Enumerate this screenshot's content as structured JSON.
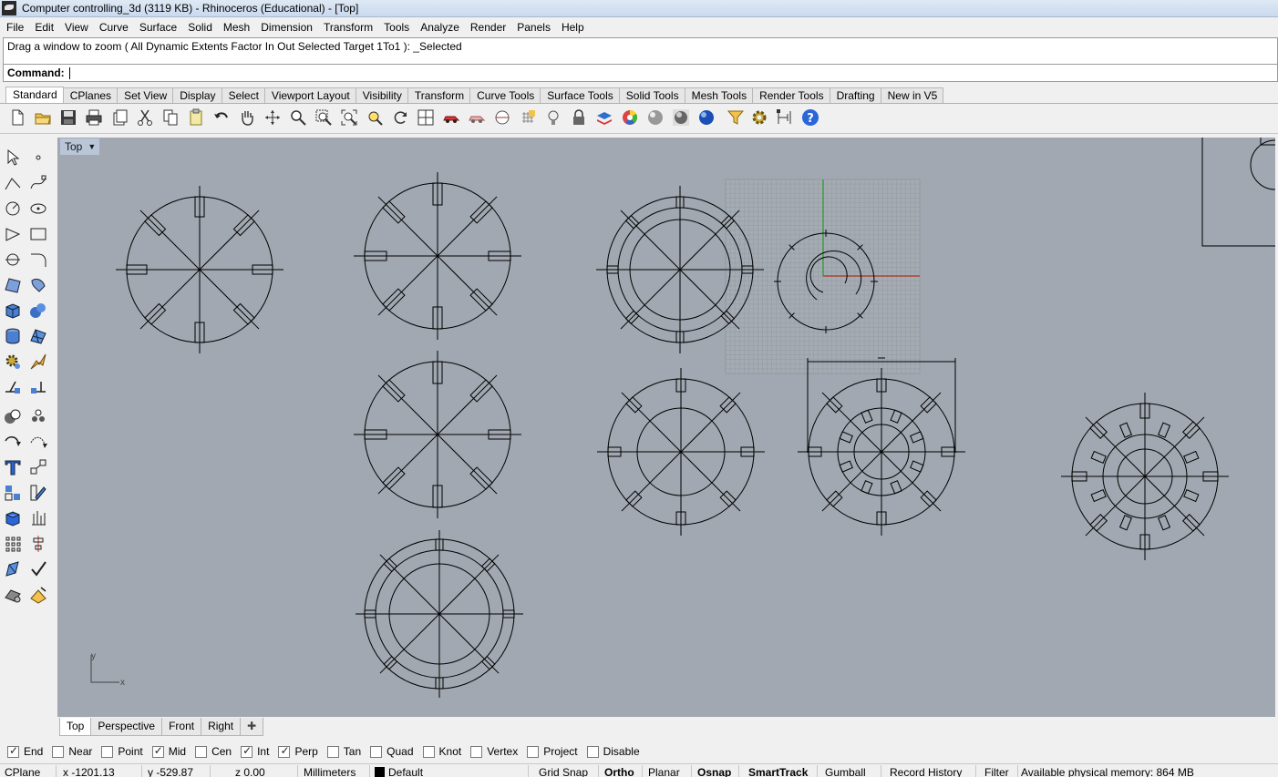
{
  "title": "Computer controlling_3d (3119 KB) - Rhinoceros (Educational) - [Top]",
  "menu": [
    "File",
    "Edit",
    "View",
    "Curve",
    "Surface",
    "Solid",
    "Mesh",
    "Dimension",
    "Transform",
    "Tools",
    "Analyze",
    "Render",
    "Panels",
    "Help"
  ],
  "command": {
    "history": "Drag a window to zoom ( All  Dynamic  Extents  Factor  In  Out  Selected  Target  1To1 ): _Selected",
    "label": "Command:",
    "value": ""
  },
  "toolbar_tabs": [
    "Standard",
    "CPlanes",
    "Set View",
    "Display",
    "Select",
    "Viewport Layout",
    "Visibility",
    "Transform",
    "Curve Tools",
    "Surface Tools",
    "Solid Tools",
    "Mesh Tools",
    "Render Tools",
    "Drafting",
    "New in V5"
  ],
  "toolbar_icons": [
    "new-file-icon",
    "open-folder-icon",
    "save-icon",
    "print-icon",
    "import-icon",
    "cut-icon",
    "copy-icon",
    "paste-icon",
    "undo-icon",
    "pan-hand-icon",
    "rotate-view-icon",
    "zoom-icon",
    "zoom-window-icon",
    "zoom-extents-icon",
    "zoom-selected-icon",
    "rotate-icon",
    "four-viewports-icon",
    "car-icon",
    "car-shaded-icon",
    "cplane-icon",
    "grid-snap-icon",
    "light-bulb-icon",
    "lock-icon",
    "layer-icon",
    "color-wheel-icon",
    "render-sphere-icon",
    "render-shaded-sphere-icon",
    "render-ghost-sphere-icon",
    "blue-sphere-icon",
    "filter-icon",
    "options-gear-icon",
    "dimension-icon",
    "help-icon"
  ],
  "left_tools": [
    "select-arrow-icon",
    "point-icon",
    "polyline-icon",
    "curve-icon",
    "circle-icon",
    "ellipse-icon",
    "polygon-icon",
    "rectangle-icon",
    "arc-icon",
    "fillet-curve-icon",
    "surface-icon",
    "patch-icon",
    "box-icon",
    "spheres-icon",
    "cylinder-icon",
    "mesh-icon",
    "gear-icon",
    "explode-icon",
    "extend-icon",
    "boolean-icon",
    "union-icon",
    "points-icon",
    "rotate-curve-icon",
    "scale-icon",
    "text-icon",
    "transform-icon",
    "group-icon",
    "pencil-icon",
    "solid-box-icon",
    "dimension-icon",
    "array-icon",
    "align-icon",
    "edit-icon",
    "check-icon",
    "shade-icon",
    "render-icon"
  ],
  "viewport": {
    "name": "Top",
    "axis_x": "x",
    "axis_y": "y"
  },
  "viewport_tabs": [
    "Top",
    "Perspective",
    "Front",
    "Right"
  ],
  "osnaps": [
    {
      "label": "End",
      "checked": true
    },
    {
      "label": "Near",
      "checked": false
    },
    {
      "label": "Point",
      "checked": false
    },
    {
      "label": "Mid",
      "checked": true
    },
    {
      "label": "Cen",
      "checked": false
    },
    {
      "label": "Int",
      "checked": true
    },
    {
      "label": "Perp",
      "checked": true
    },
    {
      "label": "Tan",
      "checked": false
    },
    {
      "label": "Quad",
      "checked": false
    },
    {
      "label": "Knot",
      "checked": false
    },
    {
      "label": "Vertex",
      "checked": false
    },
    {
      "label": "Project",
      "checked": false
    },
    {
      "label": "Disable",
      "checked": false
    }
  ],
  "status": {
    "cplane": "CPlane",
    "x": "x -1201.13",
    "y": "y -529.87",
    "z": "z 0.00",
    "units": "Millimeters",
    "layer": "Default",
    "grid_snap": "Grid Snap",
    "ortho": "Ortho",
    "planar": "Planar",
    "osnap": "Osnap",
    "smarttrack": "SmartTrack",
    "gumball": "Gumball",
    "record_history": "Record History",
    "filter": "Filter",
    "memory": "Available physical memory: 864 MB"
  },
  "colors": {
    "viewport_bg": "#a1a8b1",
    "drawing_line": "#000000",
    "grid_line": "#9aa1aa",
    "x_axis": "#b03020",
    "y_axis": "#20a020"
  }
}
